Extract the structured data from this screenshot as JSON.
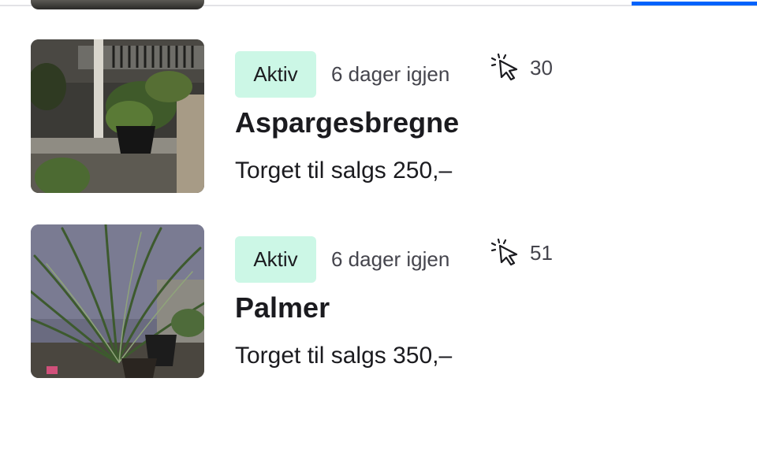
{
  "colors": {
    "accent": "#0063fb",
    "badge_bg": "#ccf7e6",
    "text": "#1b1b1f",
    "muted_text": "#45454d"
  },
  "listings": [
    {
      "status": "Aktiv",
      "time_left": "6 dager igjen",
      "click_icon": "cursor-click-icon",
      "clicks": "30",
      "title": "Aspargesbregne",
      "category": "Torget til salgs",
      "price": "250,–"
    },
    {
      "status": "Aktiv",
      "time_left": "6 dager igjen",
      "click_icon": "cursor-click-icon",
      "clicks": "51",
      "title": "Palmer",
      "category": "Torget til salgs",
      "price": "350,–"
    }
  ]
}
